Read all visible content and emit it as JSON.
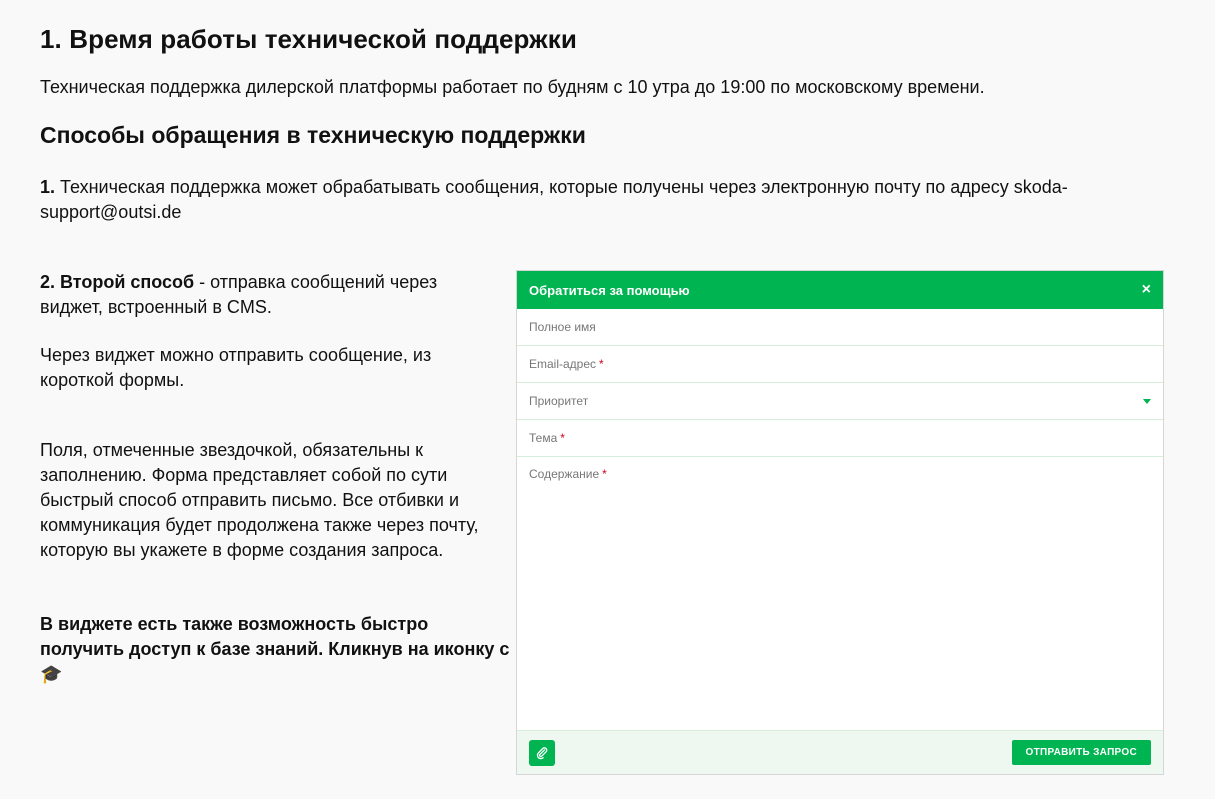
{
  "section": {
    "title": "1. Время работы технической поддержки",
    "intro": "Техническая поддержка дилерской платформы работает по будням с 10 утра до 19:00 по московскому времени."
  },
  "methods": {
    "title": "Способы обращения в техническую поддержки",
    "m1_num": "1.",
    "m1_text": " Техническая поддержка может обрабатывать сообщения, которые получены через электронную почту по адресу skoda-support@outsi.de",
    "m2_bold": "2. Второй способ",
    "m2_text": " - отправка сообщений через виджет, встроенный в CMS.",
    "widget_text": "Через виджет можно отправить сообщение, из короткой формы.",
    "fields_text": "Поля, отмеченные звездочкой, обязательны к заполнению. Форма представляет собой по сути быстрый способ отправить письмо. Все отбивки и коммуникация будет продолжена также через почту, которую вы укажете в форме создания запроса.",
    "kb_text": "В виджете есть также возможность быстро получить доступ к базе знаний. Кликнув на иконку с ",
    "kb_icon": "🎓"
  },
  "widget": {
    "title": "Обратиться за помощью",
    "close": "×",
    "fields": {
      "full_name": "Полное имя",
      "email": "Email-адрес",
      "priority": "Приоритет",
      "subject": "Тема",
      "content": "Содержание"
    },
    "required_mark": "*",
    "submit_label": "ОТПРАВИТЬ ЗАПРОС",
    "accent": "#00b451"
  }
}
